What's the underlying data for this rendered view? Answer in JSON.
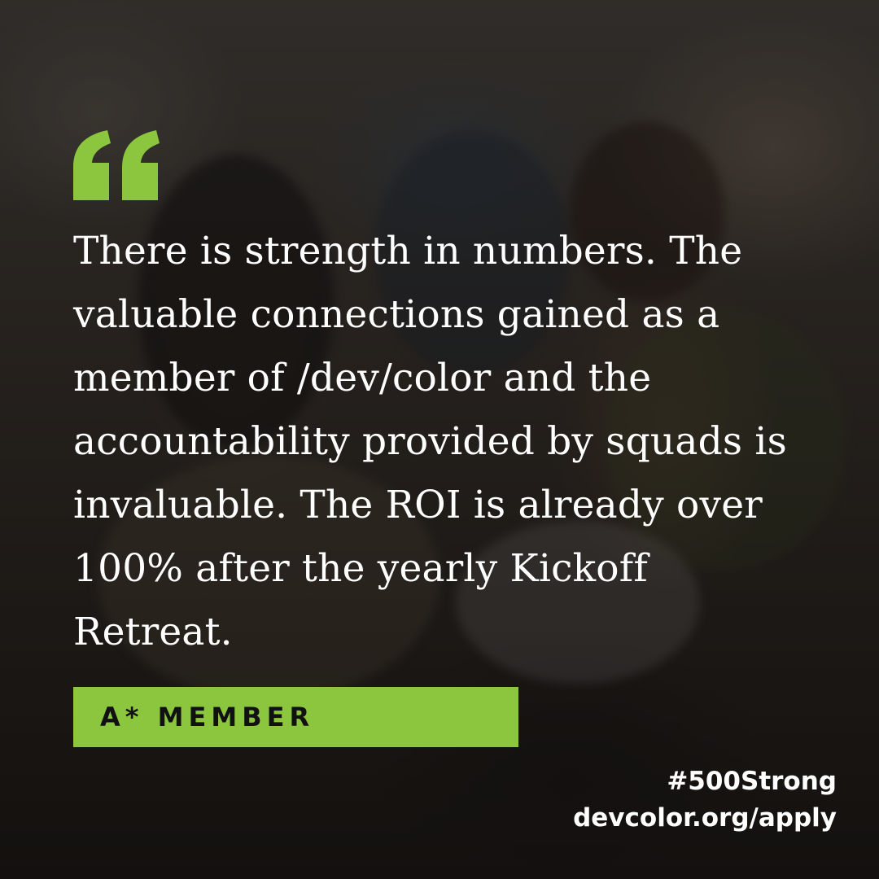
{
  "quote": {
    "text": "There is strength in numbers. The valuable connections gained as a member of /dev/color and the accountability provided by squads is invaluable. The ROI is already over 100% after the yearly Kickoff Retreat."
  },
  "attribution": {
    "label": "A* MEMBER"
  },
  "footer": {
    "hashtag": "#500Strong",
    "url": "devcolor.org/apply"
  },
  "colors": {
    "accent": "#8cc63f",
    "text": "#ffffff"
  },
  "icons": {
    "quote": "quote-mark-icon"
  }
}
